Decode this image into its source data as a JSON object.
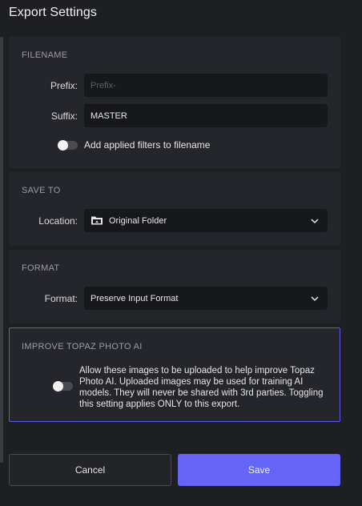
{
  "dialog": {
    "title": "Export Settings"
  },
  "filename": {
    "section": "FILENAME",
    "prefix_label": "Prefix:",
    "prefix_placeholder": "Prefix-",
    "prefix_value": "",
    "suffix_label": "Suffix:",
    "suffix_value": "MASTER",
    "filters_toggle_label": "Add applied filters to filename",
    "filters_toggle_on": false
  },
  "save_to": {
    "section": "SAVE TO",
    "location_label": "Location:",
    "location_value": "Original Folder",
    "location_icon": "folder-icon"
  },
  "format": {
    "section": "FORMAT",
    "format_label": "Format:",
    "format_value": "Preserve Input Format"
  },
  "improve": {
    "section": "IMPROVE TOPAZ PHOTO AI",
    "text": "Allow these images to be uploaded to help improve Topaz Photo AI. Uploaded images may be used for training AI models. They will never be shared with 3rd parties. Toggling this setting applies ONLY to this export.",
    "toggle_on": false
  },
  "actions": {
    "cancel": "Cancel",
    "save": "Save"
  },
  "colors": {
    "accent": "#6464f7",
    "panel": "#25262b",
    "background": "#1e1f23"
  }
}
